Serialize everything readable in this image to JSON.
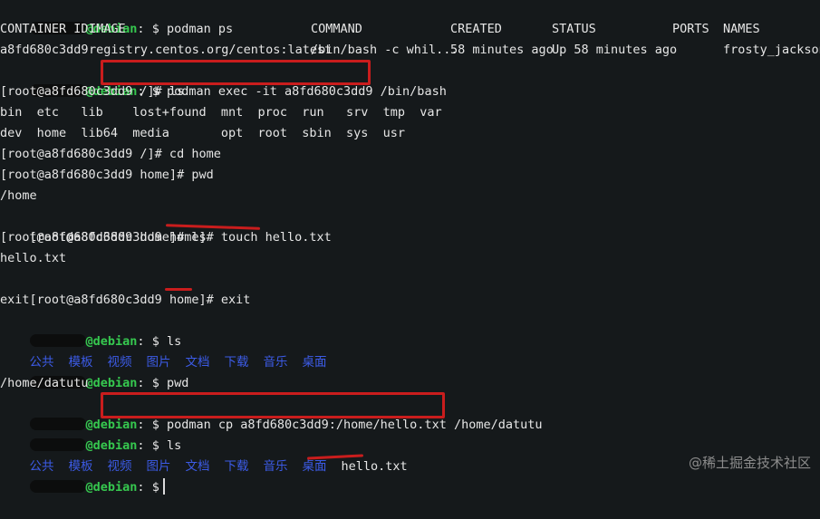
{
  "prompt": {
    "host": "@debian",
    "symbol": "$"
  },
  "lines": {
    "l1_cmd": "podman ps",
    "ps_header": [
      "CONTAINER ID",
      "IMAGE",
      "COMMAND",
      "CREATED",
      "STATUS",
      "PORTS",
      "NAMES"
    ],
    "ps_row": [
      "a8fd680c3dd9",
      "registry.centos.org/centos:latest",
      "/bin/bash -c whil...",
      "58 minutes ago",
      "Up 58 minutes ago",
      "",
      "frosty_jackson"
    ],
    "l4_cmd": "podman exec -it a8fd680c3dd9 /bin/bash",
    "l5": "[root@a8fd680c3dd9 /]# ls",
    "l6": "bin  etc   lib    lost+found  mnt  proc  run   srv  tmp  var",
    "l7": "dev  home  lib64  media       opt  root  sbin  sys  usr",
    "l8": "[root@a8fd680c3dd9 /]# cd home",
    "l9": "[root@a8fd680c3dd9 home]# pwd",
    "l10": "/home",
    "l11_prefix": "[root@a8fd680c3dd9 home]# ",
    "l11_cmd": "touch hello.txt",
    "l12": "[root@a8fd680c3dd9 home]# ls",
    "l13": "hello.txt",
    "l14_prefix": "[root@a8fd680c3dd9 home]# ",
    "l14_cmd": "exit",
    "l15": "exit",
    "l16_cmd": "ls",
    "home_dirs": [
      "公共",
      "模板",
      "视频",
      "图片",
      "文档",
      "下载",
      "音乐",
      "桌面"
    ],
    "l18_cmd": "pwd",
    "l19": "/home/datutu",
    "l20_cmd": "podman cp a8fd680c3dd9:/home/hello.txt /home/datutu",
    "l21_cmd": "ls",
    "l22_file": "hello.txt"
  },
  "watermark": "@稀土掘金技术社区",
  "colors": {
    "background": "#15191b",
    "prompt_green": "#36c94f",
    "dir_blue": "#3c5be6",
    "highlight_red": "#c91d1d"
  }
}
